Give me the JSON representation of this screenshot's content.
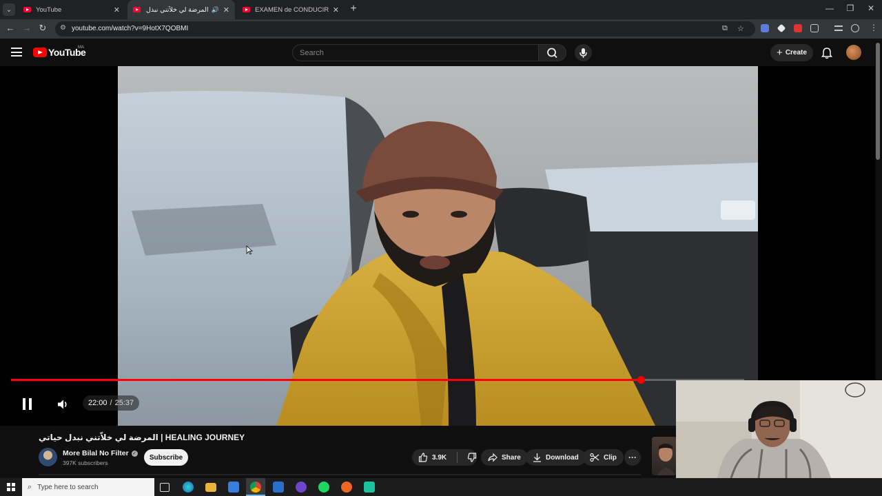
{
  "browser": {
    "tabs": [
      {
        "title": "YouTube",
        "active": false
      },
      {
        "title": "المرضة لي خلاّتني نبدل حياتي...",
        "active": true,
        "audio": true
      },
      {
        "title": "EXAMEN de CONDUCIR en ...",
        "active": false
      }
    ],
    "url": "youtube.com/watch?v=9HotX7QOBMI",
    "window_controls": {
      "minimize": "—",
      "restore": "❐",
      "close": "✕"
    },
    "new_tab": "+",
    "nav": {
      "back": "←",
      "forward": "→",
      "reload": "↻"
    }
  },
  "youtube": {
    "logo_text": "YouTube",
    "region": "MA",
    "search_placeholder": "Search",
    "create_label": "Create"
  },
  "player": {
    "current_time": "22:00",
    "duration": "25:37",
    "progress_fraction": 0.859,
    "state": "playing"
  },
  "video": {
    "title": "المرضة لي خلاّتني نبدل حياتي | HEALING JOURNEY",
    "channel": "More Bilal No Filter",
    "subscribers": "397K subscribers",
    "subscribe_label": "Subscribe",
    "likes": "3.9K",
    "share_label": "Share",
    "download_label": "Download",
    "clip_label": "Clip",
    "more_label": "···"
  },
  "taskbar": {
    "search_placeholder": "Type here to search"
  },
  "colors": {
    "accent": "#ff0000",
    "background": "#0f0f0f",
    "pill": "#272727"
  }
}
